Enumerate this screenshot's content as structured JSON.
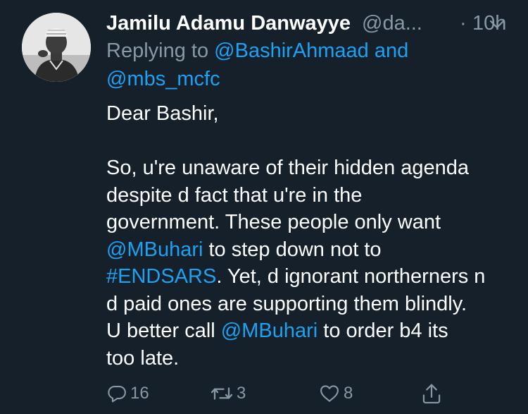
{
  "tweet": {
    "display_name": "Jamilu Adamu Danwayye",
    "handle": "@da...",
    "separator": "·",
    "time": "10h",
    "reply_prefix": "Replying to ",
    "reply_mention_1": "@BashirAhmaad",
    "reply_and": " and",
    "reply_mention_2": "@mbs_mcfc",
    "body": {
      "greeting": "Dear Bashir,",
      "l1": "So, u're unaware of their hidden agenda",
      "l2": "despite d fact that u're in the",
      "l3": "government. These people only want",
      "l4_mention": "@MBuhari",
      "l4_rest": " to step down not to",
      "l5_hashtag": "#ENDSARS",
      "l5_rest": ". Yet, d ignorant northerners n",
      "l6": "d paid ones are supporting them blindly.",
      "l7_pre": "U better call ",
      "l7_mention": "@MBuhari",
      "l7_rest": " to order b4 its",
      "l8": "too late."
    },
    "actions": {
      "replies": "16",
      "retweets": "3",
      "likes": "8"
    }
  },
  "icons": {
    "avatar": "profile-photo",
    "caret": "chevron-down-icon",
    "reply": "comment-bubble-icon",
    "retweet": "retweet-icon",
    "like": "heart-icon",
    "share": "share-icon"
  },
  "colors": {
    "background": "#15202b",
    "text": "#ffffff",
    "muted": "#8899a6",
    "link": "#1da1f2"
  }
}
